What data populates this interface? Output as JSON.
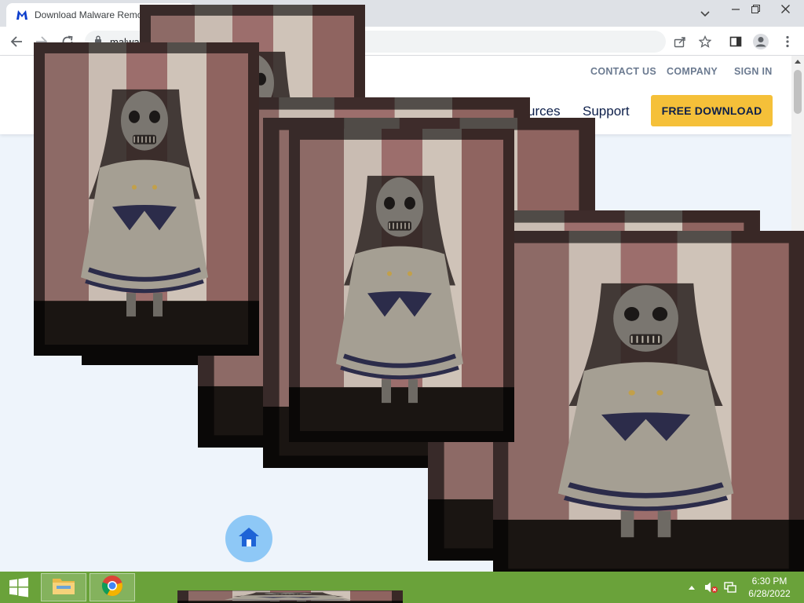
{
  "browser": {
    "tab_title": "Download Malware Remo",
    "address": "malwa",
    "icons": {
      "favicon": "malwarebytes-m-icon",
      "back": "back-arrow-icon",
      "forward": "forward-arrow-icon",
      "reload": "reload-icon",
      "lock": "lock-icon",
      "share": "share-icon",
      "bookmark": "star-icon",
      "side_panel": "side-panel-icon",
      "profile": "profile-icon",
      "menu": "kebab-menu-icon"
    }
  },
  "site": {
    "utility_links": [
      "CONTACT US",
      "COMPANY",
      "SIGN IN"
    ],
    "nav": {
      "resources_partial": "urces",
      "support": "Support"
    },
    "cta_label": "FREE DOWNLOAD",
    "brand_color": "#0d3ecc",
    "cta_color": "#f5c039"
  },
  "popups": {
    "description_note": "",
    "count": 8
  },
  "taskbar": {
    "clock_time": "6:30 PM",
    "clock_date": "6/28/2022",
    "color": "#6aa23a"
  }
}
